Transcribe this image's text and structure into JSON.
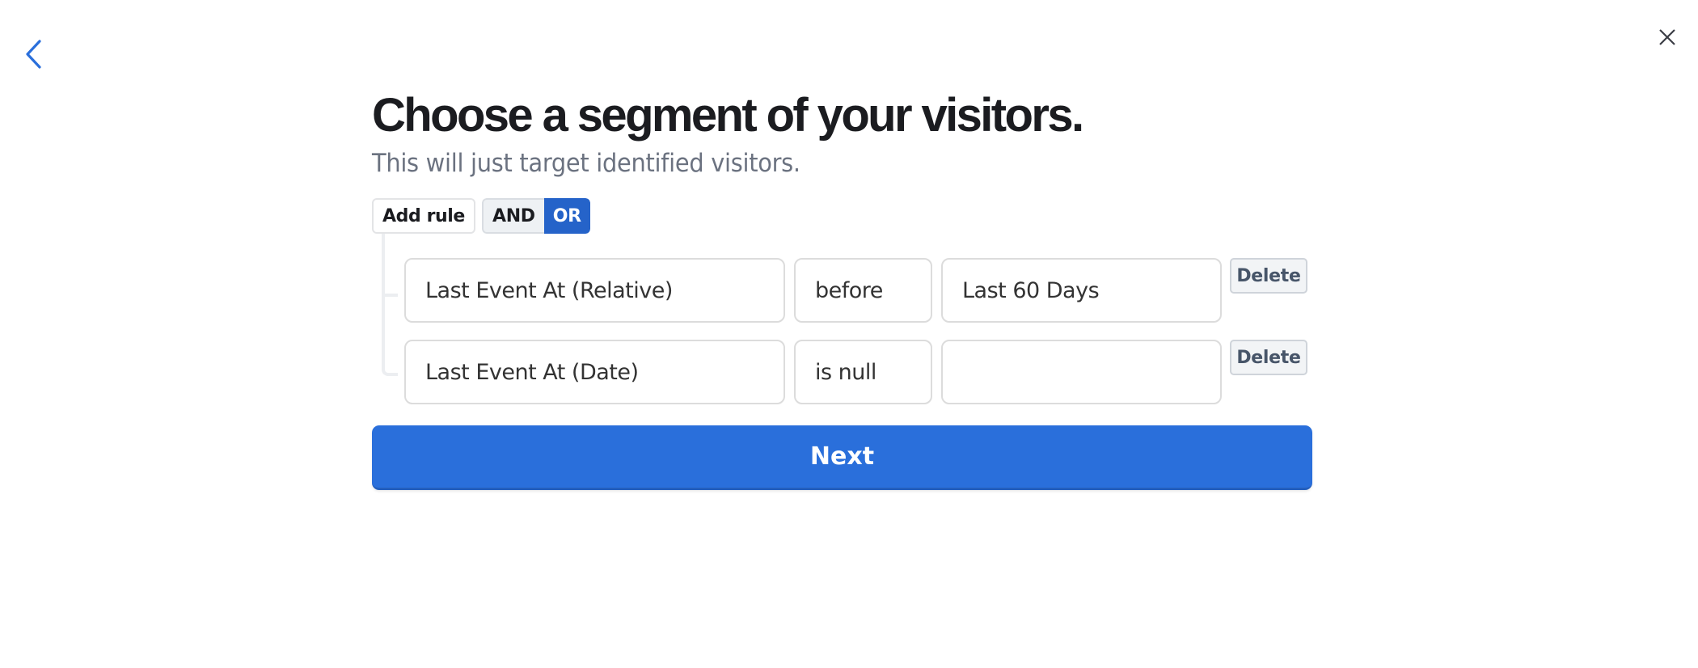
{
  "navigation": {
    "back_icon": "chevron-left-icon",
    "close_icon": "close-icon"
  },
  "header": {
    "title": "Choose a segment of your visitors.",
    "subtitle": "This will just target identified visitors."
  },
  "toolbar": {
    "add_rule_label": "Add rule",
    "logic_options": [
      "AND",
      "OR"
    ],
    "logic_selected": "OR"
  },
  "rules": [
    {
      "property": "Last Event At (Relative)",
      "operator": "before",
      "value": "Last 60 Days",
      "delete_label": "Delete"
    },
    {
      "property": "Last Event At (Date)",
      "operator": "is null",
      "value": "",
      "delete_label": "Delete"
    }
  ],
  "footer": {
    "next_label": "Next"
  },
  "colors": {
    "accent": "#2a6fdb",
    "toggle_active": "#2563c9",
    "title": "#1b1c20",
    "subtitle": "#6b7280"
  }
}
